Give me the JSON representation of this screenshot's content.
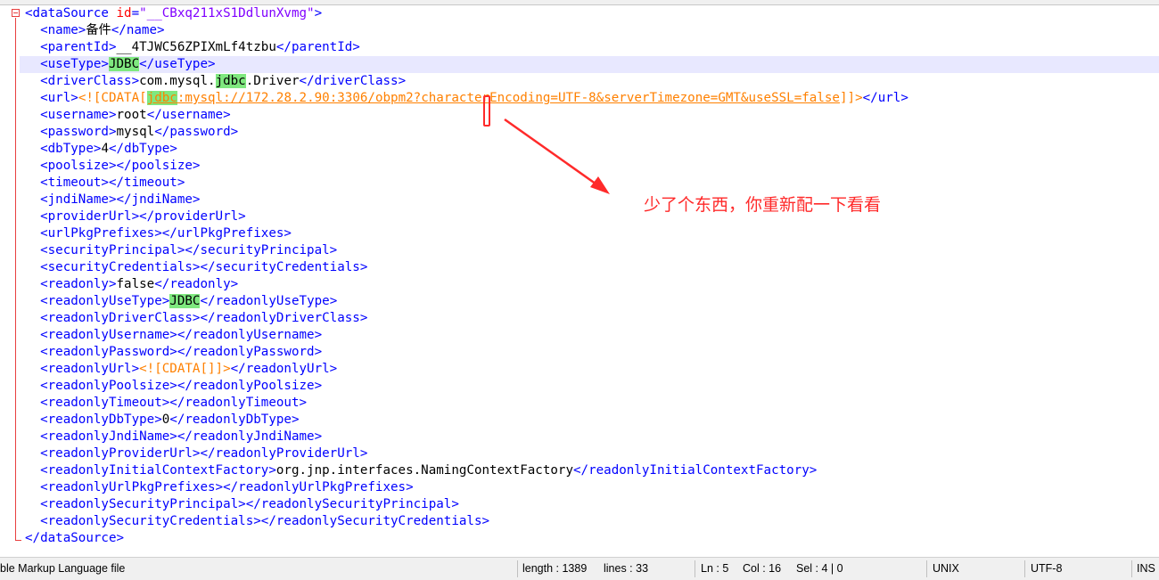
{
  "editor": {
    "lines": [
      {
        "segments": [
          {
            "c": "tag",
            "t": "<dataSource "
          },
          {
            "c": "attr",
            "t": "id"
          },
          {
            "c": "tag",
            "t": "="
          },
          {
            "c": "val",
            "t": "\"__CBxq211xS1DdlunXvmg\""
          },
          {
            "c": "tag",
            "t": ">"
          }
        ]
      },
      {
        "segments": [
          {
            "c": "txt",
            "t": "  "
          },
          {
            "c": "tag",
            "t": "<name>"
          },
          {
            "c": "txt",
            "t": "备件"
          },
          {
            "c": "tag",
            "t": "</name>"
          }
        ]
      },
      {
        "segments": [
          {
            "c": "txt",
            "t": "  "
          },
          {
            "c": "tag",
            "t": "<parentId>"
          },
          {
            "c": "txt",
            "t": "__4TJWC56ZPIXmLf4tzbu"
          },
          {
            "c": "tag",
            "t": "</parentId>"
          }
        ]
      },
      {
        "current": true,
        "segments": [
          {
            "c": "txt",
            "t": "  "
          },
          {
            "c": "tag",
            "t": "<useType>"
          },
          {
            "c": "txt hl",
            "t": "JDBC"
          },
          {
            "c": "tag",
            "t": "</useType>"
          }
        ]
      },
      {
        "segments": [
          {
            "c": "txt",
            "t": "  "
          },
          {
            "c": "tag",
            "t": "<driverClass>"
          },
          {
            "c": "txt",
            "t": "com.mysql."
          },
          {
            "c": "txt hl",
            "t": "jdbc"
          },
          {
            "c": "txt",
            "t": ".Driver"
          },
          {
            "c": "tag",
            "t": "</driverClass>"
          }
        ]
      },
      {
        "segments": [
          {
            "c": "txt",
            "t": "  "
          },
          {
            "c": "tag",
            "t": "<url>"
          },
          {
            "c": "cdata",
            "t": "<![CDATA["
          },
          {
            "c": "cdata-url hl",
            "t": "jdbc"
          },
          {
            "c": "cdata-url",
            "t": ":mysql://172.28.2.90:3306/obpm2?characterEncoding=UTF-8&serverTimezone=GMT&useSSL=false"
          },
          {
            "c": "cdata",
            "t": "]]>"
          },
          {
            "c": "tag",
            "t": "</url>"
          }
        ]
      },
      {
        "segments": [
          {
            "c": "txt",
            "t": "  "
          },
          {
            "c": "tag",
            "t": "<username>"
          },
          {
            "c": "txt",
            "t": "root"
          },
          {
            "c": "tag",
            "t": "</username>"
          }
        ]
      },
      {
        "segments": [
          {
            "c": "txt",
            "t": "  "
          },
          {
            "c": "tag",
            "t": "<password>"
          },
          {
            "c": "txt",
            "t": "mysql"
          },
          {
            "c": "tag",
            "t": "</password>"
          }
        ]
      },
      {
        "segments": [
          {
            "c": "txt",
            "t": "  "
          },
          {
            "c": "tag",
            "t": "<dbType>"
          },
          {
            "c": "txt",
            "t": "4"
          },
          {
            "c": "tag",
            "t": "</dbType>"
          }
        ]
      },
      {
        "segments": [
          {
            "c": "txt",
            "t": "  "
          },
          {
            "c": "tag",
            "t": "<poolsize></poolsize>"
          }
        ]
      },
      {
        "segments": [
          {
            "c": "txt",
            "t": "  "
          },
          {
            "c": "tag",
            "t": "<timeout></timeout>"
          }
        ]
      },
      {
        "segments": [
          {
            "c": "txt",
            "t": "  "
          },
          {
            "c": "tag",
            "t": "<jndiName></jndiName>"
          }
        ]
      },
      {
        "segments": [
          {
            "c": "txt",
            "t": "  "
          },
          {
            "c": "tag",
            "t": "<providerUrl></providerUrl>"
          }
        ]
      },
      {
        "segments": [
          {
            "c": "txt",
            "t": "  "
          },
          {
            "c": "tag",
            "t": "<urlPkgPrefixes></urlPkgPrefixes>"
          }
        ]
      },
      {
        "segments": [
          {
            "c": "txt",
            "t": "  "
          },
          {
            "c": "tag",
            "t": "<securityPrincipal></securityPrincipal>"
          }
        ]
      },
      {
        "segments": [
          {
            "c": "txt",
            "t": "  "
          },
          {
            "c": "tag",
            "t": "<securityCredentials></securityCredentials>"
          }
        ]
      },
      {
        "segments": [
          {
            "c": "txt",
            "t": "  "
          },
          {
            "c": "tag",
            "t": "<readonly>"
          },
          {
            "c": "txt",
            "t": "false"
          },
          {
            "c": "tag",
            "t": "</readonly>"
          }
        ]
      },
      {
        "segments": [
          {
            "c": "txt",
            "t": "  "
          },
          {
            "c": "tag",
            "t": "<readonlyUseType>"
          },
          {
            "c": "txt hl",
            "t": "JDBC"
          },
          {
            "c": "tag",
            "t": "</readonlyUseType>"
          }
        ]
      },
      {
        "segments": [
          {
            "c": "txt",
            "t": "  "
          },
          {
            "c": "tag",
            "t": "<readonlyDriverClass></readonlyDriverClass>"
          }
        ]
      },
      {
        "segments": [
          {
            "c": "txt",
            "t": "  "
          },
          {
            "c": "tag",
            "t": "<readonlyUsername></readonlyUsername>"
          }
        ]
      },
      {
        "segments": [
          {
            "c": "txt",
            "t": "  "
          },
          {
            "c": "tag",
            "t": "<readonlyPassword></readonlyPassword>"
          }
        ]
      },
      {
        "segments": [
          {
            "c": "txt",
            "t": "  "
          },
          {
            "c": "tag",
            "t": "<readonlyUrl>"
          },
          {
            "c": "cdata",
            "t": "<![CDATA[]]>"
          },
          {
            "c": "tag",
            "t": "</readonlyUrl>"
          }
        ]
      },
      {
        "segments": [
          {
            "c": "txt",
            "t": "  "
          },
          {
            "c": "tag",
            "t": "<readonlyPoolsize></readonlyPoolsize>"
          }
        ]
      },
      {
        "segments": [
          {
            "c": "txt",
            "t": "  "
          },
          {
            "c": "tag",
            "t": "<readonlyTimeout></readonlyTimeout>"
          }
        ]
      },
      {
        "segments": [
          {
            "c": "txt",
            "t": "  "
          },
          {
            "c": "tag",
            "t": "<readonlyDbType>"
          },
          {
            "c": "txt",
            "t": "0"
          },
          {
            "c": "tag",
            "t": "</readonlyDbType>"
          }
        ]
      },
      {
        "segments": [
          {
            "c": "txt",
            "t": "  "
          },
          {
            "c": "tag",
            "t": "<readonlyJndiName></readonlyJndiName>"
          }
        ]
      },
      {
        "segments": [
          {
            "c": "txt",
            "t": "  "
          },
          {
            "c": "tag",
            "t": "<readonlyProviderUrl></readonlyProviderUrl>"
          }
        ]
      },
      {
        "segments": [
          {
            "c": "txt",
            "t": "  "
          },
          {
            "c": "tag",
            "t": "<readonlyInitialContextFactory>"
          },
          {
            "c": "txt",
            "t": "org.jnp.interfaces.NamingContextFactory"
          },
          {
            "c": "tag",
            "t": "</readonlyInitialContextFactory>"
          }
        ]
      },
      {
        "segments": [
          {
            "c": "txt",
            "t": "  "
          },
          {
            "c": "tag",
            "t": "<readonlyUrlPkgPrefixes></readonlyUrlPkgPrefixes>"
          }
        ]
      },
      {
        "segments": [
          {
            "c": "txt",
            "t": "  "
          },
          {
            "c": "tag",
            "t": "<readonlySecurityPrincipal></readonlySecurityPrincipal>"
          }
        ]
      },
      {
        "segments": [
          {
            "c": "txt",
            "t": "  "
          },
          {
            "c": "tag",
            "t": "<readonlySecurityCredentials></readonlySecurityCredentials>"
          }
        ]
      },
      {
        "segments": [
          {
            "c": "tag",
            "t": "</dataSource>"
          }
        ]
      }
    ]
  },
  "annotation": {
    "text": "少了个东西，你重新配一下看看",
    "color": "#ff2a2a"
  },
  "statusbar": {
    "file_type": "ble Markup Language file",
    "length": "length : 1389",
    "lines": "lines : 33",
    "ln": "Ln : 5",
    "col": "Col : 16",
    "sel": "Sel : 4 | 0",
    "eol": "UNIX",
    "encoding": "UTF-8",
    "mode": "INS"
  }
}
